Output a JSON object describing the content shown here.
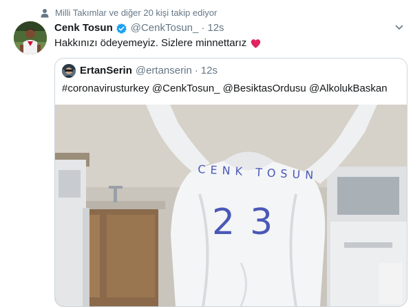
{
  "social_context": {
    "text": "Milli Takımlar ve diğer 20 kişi takip ediyor",
    "icon": "person-icon"
  },
  "tweet": {
    "display_name": "Cenk Tosun",
    "handle": "@CenkTosun_",
    "separator": "·",
    "time": "12s",
    "text": "Hakkınızı ödeyemeyiz. Sizlere minnettarız",
    "emoji": "red-heart",
    "verified_color": "#1da1f2",
    "heart_color": "#e0245e"
  },
  "quoted_tweet": {
    "display_name": "ErtanSerin",
    "handle": "@ertanserin",
    "separator": "·",
    "time": "12s",
    "text": "#coronavirusturkey @CenkTosun_ @BesiktasOrdusu @AlkolukBaskan",
    "image_writing": {
      "name": "CENK TOSUN",
      "number": "23"
    }
  },
  "colors": {
    "text_primary": "#14171a",
    "text_secondary": "#657786",
    "border": "#ccd6dd"
  }
}
